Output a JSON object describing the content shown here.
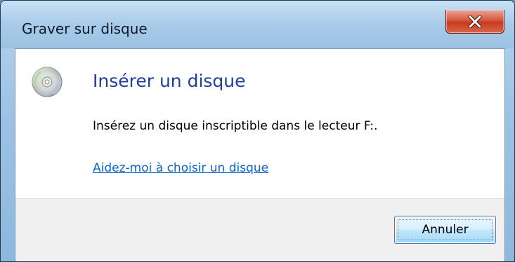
{
  "window": {
    "title": "Graver sur disque",
    "close_icon": "close-icon"
  },
  "content": {
    "icon": "disc-icon",
    "heading": "Insérer un disque",
    "message": "Insérez un disque inscriptible dans le lecteur F:.",
    "help_link": "Aidez-moi à choisir un disque"
  },
  "footer": {
    "cancel_label": "Annuler"
  },
  "colors": {
    "heading": "#1e3f9c",
    "link": "#0a64c8",
    "close_button": "#c73a1f",
    "footer_background": "#f0f0f0"
  }
}
